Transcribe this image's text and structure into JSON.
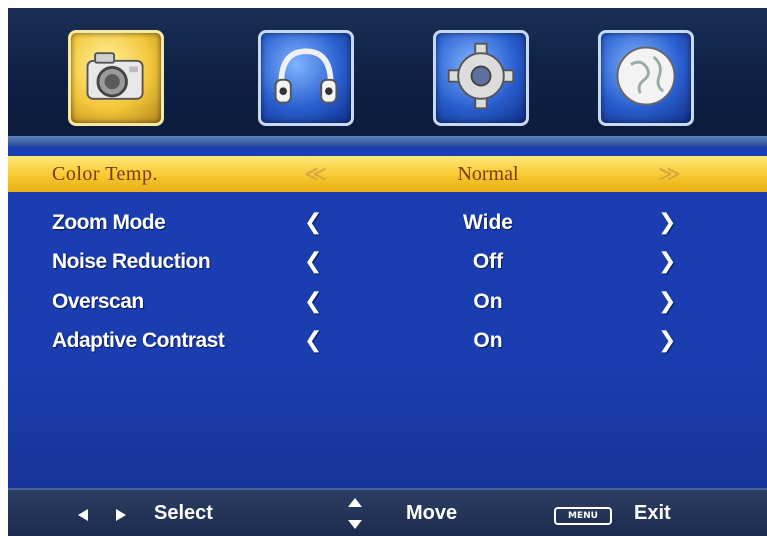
{
  "tabs": [
    {
      "name": "picture",
      "icon": "camera-icon",
      "active": true
    },
    {
      "name": "sound",
      "icon": "headphones-icon",
      "active": false
    },
    {
      "name": "setup",
      "icon": "gear-icon",
      "active": false
    },
    {
      "name": "world",
      "icon": "globe-icon",
      "active": false
    }
  ],
  "rows": [
    {
      "label": "Color Temp.",
      "value": "Normal",
      "left": "≪",
      "right": "≫",
      "selected": true
    },
    {
      "label": "Zoom Mode",
      "value": "Wide",
      "left": "❮",
      "right": "❯",
      "selected": false
    },
    {
      "label": "Noise Reduction",
      "value": "Off",
      "left": "❮",
      "right": "❯",
      "selected": false
    },
    {
      "label": "Overscan",
      "value": "On",
      "left": "❮",
      "right": "❯",
      "selected": false
    },
    {
      "label": "Adaptive Contrast",
      "value": "On",
      "left": "❮",
      "right": "❯",
      "selected": false
    }
  ],
  "footer": {
    "select_label": "Select",
    "move_label": "Move",
    "menu_key": "MENU",
    "exit_label": "Exit"
  },
  "colors": {
    "highlight": "#f6c92f",
    "menu_bg": "#1a3fb3",
    "frame": "#0a1d3f"
  }
}
